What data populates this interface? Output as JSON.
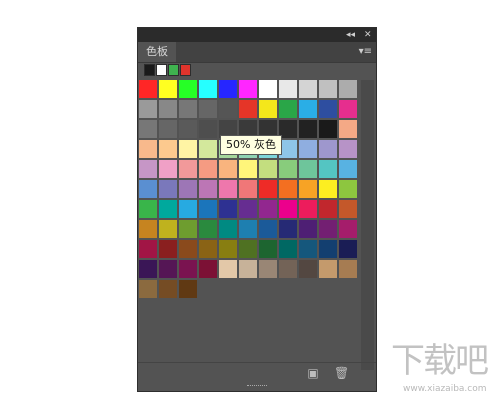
{
  "panel": {
    "collapse_glyph": "◂◂",
    "close_glyph": "✕",
    "tab_label": "色板",
    "menu_glyph": "▾≡"
  },
  "recent_swatches": [
    "#1a1a1a",
    "#ffffff",
    "#3fb24f",
    "#e0342c"
  ],
  "swatch_rows": [
    [
      "#ff2626",
      "#ffff21",
      "#26ff26",
      "#26ffff",
      "#2626ff",
      "#ff26ff",
      "#ffffff",
      "#e8e8e8",
      "#d4d4d4",
      "#c0c0c0",
      "#acacac"
    ],
    [
      "#9a9a9a",
      "#888888",
      "#777777",
      "#666666",
      "#555555",
      "#e53528",
      "#f4e71b",
      "#2aa648",
      "#2aaee6",
      "#2e4ea0",
      "#e62e8e"
    ],
    [
      "#777777",
      "#666666",
      "#5a5a5a",
      "#4e4e4e",
      "#444444",
      "#3a3a3a",
      "#333333",
      "#2a2a2a",
      "#222222",
      "#1a1a1a",
      "#f4a986"
    ],
    [
      "#f8b98c",
      "#fcc98e",
      "#fff4a4",
      "#d3e89c",
      "#a4d59a",
      "#8fd3b3",
      "#7fd6da",
      "#8ec5e8",
      "#8faee0",
      "#9e97cd",
      "#b793c7"
    ],
    [
      "#c696c6",
      "#f0a0c6",
      "#f2999a",
      "#f59b82",
      "#f9b47e",
      "#fff57a",
      "#c3de7f",
      "#88cc7c",
      "#6ec59b",
      "#54c5c2",
      "#58b2e2"
    ],
    [
      "#5a8fd1",
      "#7a78bb",
      "#9d76b6",
      "#bc76b5",
      "#ee77ac",
      "#f07778",
      "#ee2b27",
      "#f36f21",
      "#f7a325",
      "#fcee21",
      "#8dc63f"
    ],
    [
      "#39b54a",
      "#00a99d",
      "#27aae1",
      "#1b75bb",
      "#2e3192",
      "#662d91",
      "#92278f",
      "#ec008c",
      "#ed1c5c",
      "#c1272d",
      "#c4582a"
    ],
    [
      "#c68420",
      "#bfb21e",
      "#6e9d2f",
      "#2a8a3e",
      "#008a82",
      "#1e7fb0",
      "#1b5a99",
      "#262a75",
      "#4e1f74",
      "#731f72",
      "#a51d6b"
    ],
    [
      "#a11545",
      "#8a1f1f",
      "#8a4a1c",
      "#8a6315",
      "#887e11",
      "#4f7122",
      "#1d6530",
      "#006863",
      "#15577c",
      "#133f70",
      "#1a1d55"
    ],
    [
      "#3a1656",
      "#551655",
      "#7a1350",
      "#7c1135",
      "#e3c8a8",
      "#c7b299",
      "#998675",
      "#736357",
      "#534741",
      "#c49a6c",
      "#a67c52"
    ],
    [
      "#8b6a3f",
      "#754c24",
      "#603913"
    ]
  ],
  "tooltip": {
    "text": "50% 灰色"
  },
  "bottom": {
    "new_icon": "▣",
    "delete_icon": "🗑"
  },
  "watermark": {
    "brand": "下载吧",
    "url": "www.xiazaiba.com"
  }
}
